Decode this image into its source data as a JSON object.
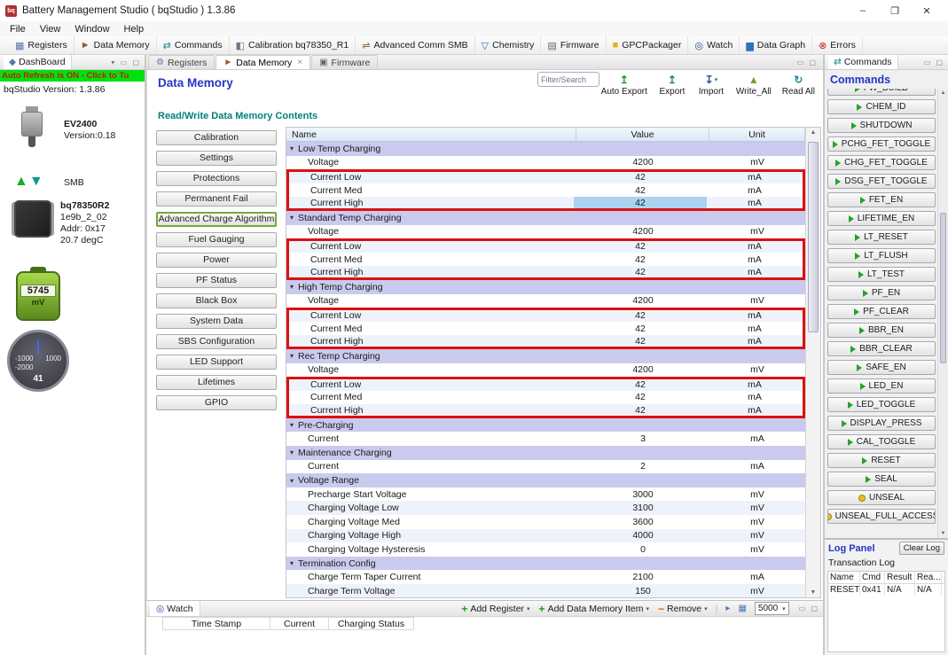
{
  "window": {
    "title": "Battery Management Studio ( bqStudio ) 1.3.86"
  },
  "menu": {
    "items": [
      "File",
      "View",
      "Window",
      "Help"
    ]
  },
  "toolbar": {
    "items": [
      {
        "label": "Registers",
        "icon": "registers-icon",
        "glyph": "▦",
        "color": "#5878a8"
      },
      {
        "label": "Data Memory",
        "icon": "data-memory-icon",
        "glyph": "►",
        "color": "#9a5a28"
      },
      {
        "label": "Commands",
        "icon": "commands-icon",
        "glyph": "⇄",
        "color": "#1d8f8f"
      },
      {
        "label": "Calibration bq78350_R1",
        "icon": "calibration-icon",
        "glyph": "◧",
        "color": "#687888"
      },
      {
        "label": "Advanced Comm SMB",
        "icon": "advanced-comm-icon",
        "glyph": "⇌",
        "color": "#8a6a3a"
      },
      {
        "label": "Chemistry",
        "icon": "chemistry-flask-icon",
        "glyph": "▽",
        "color": "#3a6ab0"
      },
      {
        "label": "Firmware",
        "icon": "firmware-chip-icon",
        "glyph": "▤",
        "color": "#606870"
      },
      {
        "label": "GPCPackager",
        "icon": "package-icon",
        "glyph": "■",
        "color": "#e0b010"
      },
      {
        "label": "Watch",
        "icon": "watch-icon",
        "glyph": "◎",
        "color": "#2a4a9a"
      },
      {
        "label": "Data Graph",
        "icon": "graph-icon",
        "glyph": "▆",
        "color": "#3070c0"
      },
      {
        "label": "Errors",
        "icon": "errors-icon",
        "glyph": "⊗",
        "color": "#c02020"
      }
    ]
  },
  "dashboard": {
    "tab": "DashBoard",
    "auto_refresh": "Auto Refresh is ON - Click to Tu",
    "version": "bqStudio Version:  1.3.86",
    "adapter": {
      "name": "EV2400",
      "version": "Version:0.18"
    },
    "bus": "SMB",
    "device": {
      "name": "bq78350R2",
      "fw": "1e9b_2_02",
      "addr": "Addr: 0x17",
      "temp": "20.7 degC"
    },
    "battery": {
      "value": "5745",
      "unit": "mV"
    },
    "gauge": {
      "labels": [
        "-1000",
        "1000",
        "-2000"
      ],
      "value": "41"
    }
  },
  "main": {
    "tabs": [
      "Registers",
      "Data Memory",
      "Firmware"
    ],
    "title": "Data Memory",
    "subtitle": "Read/Write Data Memory Contents",
    "filter_placeholder": "Filter/Search",
    "actions": [
      {
        "label": "Auto Export",
        "icon": "auto-export-icon",
        "glyph": "↥",
        "color": "#2a9a2a",
        "caret": false
      },
      {
        "label": "Export",
        "icon": "export-icon",
        "glyph": "↥",
        "color": "#2a7a9a",
        "caret": false
      },
      {
        "label": "Import",
        "icon": "import-icon",
        "glyph": "↧",
        "color": "#2a5aaa",
        "caret": true
      },
      {
        "label": "Write_All",
        "icon": "write-all-icon",
        "glyph": "▲",
        "color": "#70a030",
        "caret": false
      },
      {
        "label": "Read All",
        "icon": "read-all-icon",
        "glyph": "↻",
        "color": "#1d8fa0",
        "caret": false
      }
    ],
    "categories": [
      "Calibration",
      "Settings",
      "Protections",
      "Permanent Fail",
      "Advanced Charge Algorithm",
      "Fuel Gauging",
      "Power",
      "PF Status",
      "Black Box",
      "System Data",
      "SBS Configuration",
      "LED Support",
      "Lifetimes",
      "GPIO"
    ],
    "selected_category": "Advanced Charge Algorithm",
    "table": {
      "headers": [
        "Name",
        "Value",
        "Unit"
      ],
      "sections": [
        {
          "name": "Low Temp Charging",
          "rows": [
            {
              "name": "Voltage",
              "value": "4200",
              "unit": "mV"
            },
            {
              "name": "Current Low",
              "value": "42",
              "unit": "mA",
              "boxed": true
            },
            {
              "name": "Current Med",
              "value": "42",
              "unit": "mA",
              "boxed": true
            },
            {
              "name": "Current High",
              "value": "42",
              "unit": "mA",
              "boxed": true,
              "selected": true
            }
          ]
        },
        {
          "name": "Standard Temp Charging",
          "rows": [
            {
              "name": "Voltage",
              "value": "4200",
              "unit": "mV"
            },
            {
              "name": "Current Low",
              "value": "42",
              "unit": "mA",
              "boxed": true
            },
            {
              "name": "Current Med",
              "value": "42",
              "unit": "mA",
              "boxed": true
            },
            {
              "name": "Current High",
              "value": "42",
              "unit": "mA",
              "boxed": true
            }
          ]
        },
        {
          "name": "High Temp Charging",
          "rows": [
            {
              "name": "Voltage",
              "value": "4200",
              "unit": "mV"
            },
            {
              "name": "Current Low",
              "value": "42",
              "unit": "mA",
              "boxed": true
            },
            {
              "name": "Current Med",
              "value": "42",
              "unit": "mA",
              "boxed": true
            },
            {
              "name": "Current High",
              "value": "42",
              "unit": "mA",
              "boxed": true
            }
          ]
        },
        {
          "name": "Rec Temp Charging",
          "rows": [
            {
              "name": "Voltage",
              "value": "4200",
              "unit": "mV"
            },
            {
              "name": "Current Low",
              "value": "42",
              "unit": "mA",
              "boxed": true
            },
            {
              "name": "Current Med",
              "value": "42",
              "unit": "mA",
              "boxed": true
            },
            {
              "name": "Current High",
              "value": "42",
              "unit": "mA",
              "boxed": true
            }
          ]
        },
        {
          "name": "Pre-Charging",
          "rows": [
            {
              "name": "Current",
              "value": "3",
              "unit": "mA"
            }
          ]
        },
        {
          "name": "Maintenance Charging",
          "rows": [
            {
              "name": "Current",
              "value": "2",
              "unit": "mA"
            }
          ]
        },
        {
          "name": "Voltage Range",
          "rows": [
            {
              "name": "Precharge Start Voltage",
              "value": "3000",
              "unit": "mV"
            },
            {
              "name": "Charging Voltage Low",
              "value": "3100",
              "unit": "mV"
            },
            {
              "name": "Charging Voltage Med",
              "value": "3600",
              "unit": "mV"
            },
            {
              "name": "Charging Voltage High",
              "value": "4000",
              "unit": "mV"
            },
            {
              "name": "Charging Voltage Hysteresis",
              "value": "0",
              "unit": "mV"
            }
          ]
        },
        {
          "name": "Termination Config",
          "rows": [
            {
              "name": "Charge Term Taper Current",
              "value": "2100",
              "unit": "mA"
            },
            {
              "name": "Charge Term Voltage",
              "value": "150",
              "unit": "mV"
            }
          ]
        }
      ]
    }
  },
  "commands": {
    "tab": "Commands",
    "title": "Commands",
    "buttons": [
      {
        "label": "FW_BUILD",
        "icon": "command-icon"
      },
      {
        "label": "CHEM_ID",
        "icon": "command-icon"
      },
      {
        "label": "SHUTDOWN",
        "icon": "command-icon"
      },
      {
        "label": "PCHG_FET_TOGGLE",
        "icon": "command-icon"
      },
      {
        "label": "CHG_FET_TOGGLE",
        "icon": "command-icon"
      },
      {
        "label": "DSG_FET_TOGGLE",
        "icon": "command-icon"
      },
      {
        "label": "FET_EN",
        "icon": "command-icon"
      },
      {
        "label": "LIFETIME_EN",
        "icon": "command-icon"
      },
      {
        "label": "LT_RESET",
        "icon": "command-icon"
      },
      {
        "label": "LT_FLUSH",
        "icon": "command-icon"
      },
      {
        "label": "LT_TEST",
        "icon": "command-icon"
      },
      {
        "label": "PF_EN",
        "icon": "command-icon"
      },
      {
        "label": "PF_CLEAR",
        "icon": "command-icon"
      },
      {
        "label": "BBR_EN",
        "icon": "command-icon"
      },
      {
        "label": "BBR_CLEAR",
        "icon": "command-icon"
      },
      {
        "label": "SAFE_EN",
        "icon": "command-icon"
      },
      {
        "label": "LED_EN",
        "icon": "command-icon"
      },
      {
        "label": "LED_TOGGLE",
        "icon": "command-icon"
      },
      {
        "label": "DISPLAY_PRESS",
        "icon": "command-icon"
      },
      {
        "label": "CAL_TOGGLE",
        "icon": "command-icon"
      },
      {
        "label": "RESET",
        "icon": "command-icon"
      },
      {
        "label": "SEAL",
        "icon": "command-icon"
      },
      {
        "label": "UNSEAL",
        "icon": "key-icon"
      },
      {
        "label": "UNSEAL_FULL_ACCESS",
        "icon": "key-icon"
      }
    ]
  },
  "log": {
    "title": "Log Panel",
    "clear_label": "Clear Log",
    "subtitle": "Transaction Log",
    "headers": [
      "Name",
      "Cmd",
      "Result",
      "Rea..."
    ],
    "rows": [
      [
        "RESET",
        "0x41",
        "N/A",
        "N/A"
      ]
    ]
  },
  "watch": {
    "tab": "Watch",
    "buttons": [
      {
        "label": "Add Register",
        "icon": "add-icon",
        "glyph": "+",
        "color": "#18a018"
      },
      {
        "label": "Add Data Memory Item",
        "icon": "add-icon",
        "glyph": "+",
        "color": "#18a018"
      },
      {
        "label": "Remove",
        "icon": "remove-icon",
        "glyph": "−",
        "color": "#e06000"
      }
    ],
    "rate": "5000",
    "headers": [
      "Time Stamp",
      "Current",
      "Charging Status"
    ]
  },
  "colors": {
    "highlight_box": "#dd1010",
    "section_row": "#cacaee",
    "selected_cell": "#abd3f0",
    "auto_refresh_bg": "#00e010",
    "title_blue": "#2535c5",
    "subtitle_teal": "#00807a"
  }
}
